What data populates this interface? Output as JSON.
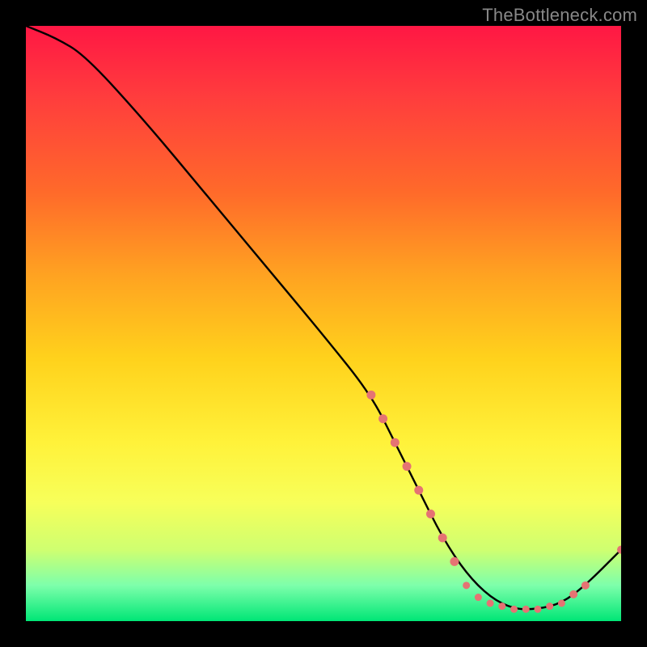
{
  "watermark": "TheBottleneck.com",
  "chart_data": {
    "type": "line",
    "title": "",
    "xlabel": "",
    "ylabel": "",
    "x_range": [
      0,
      100
    ],
    "y_range": [
      0,
      100
    ],
    "curve": {
      "x": [
        0,
        5,
        10,
        20,
        30,
        40,
        50,
        58,
        62,
        66,
        70,
        74,
        78,
        82,
        86,
        90,
        94,
        100
      ],
      "y": [
        100,
        98,
        95,
        84,
        72,
        60,
        48,
        38,
        30,
        22,
        14,
        8,
        4,
        2,
        2,
        3,
        6,
        12
      ]
    },
    "marker_clusters": [
      {
        "name": "descending-tail",
        "color": "#e57373",
        "size": 11,
        "x": [
          58,
          60,
          62,
          64,
          66,
          68,
          70,
          72
        ],
        "y": [
          38,
          34,
          30,
          26,
          22,
          18,
          14,
          10
        ]
      },
      {
        "name": "valley-floor",
        "color": "#e57373",
        "size": 9,
        "x": [
          74,
          76,
          78,
          80,
          82,
          84,
          86,
          88,
          90
        ],
        "y": [
          6,
          4,
          3,
          2.5,
          2,
          2,
          2,
          2.5,
          3
        ]
      },
      {
        "name": "rising-tail",
        "color": "#e57373",
        "size": 10,
        "x": [
          92,
          94,
          100
        ],
        "y": [
          4.5,
          6,
          12
        ]
      }
    ]
  }
}
